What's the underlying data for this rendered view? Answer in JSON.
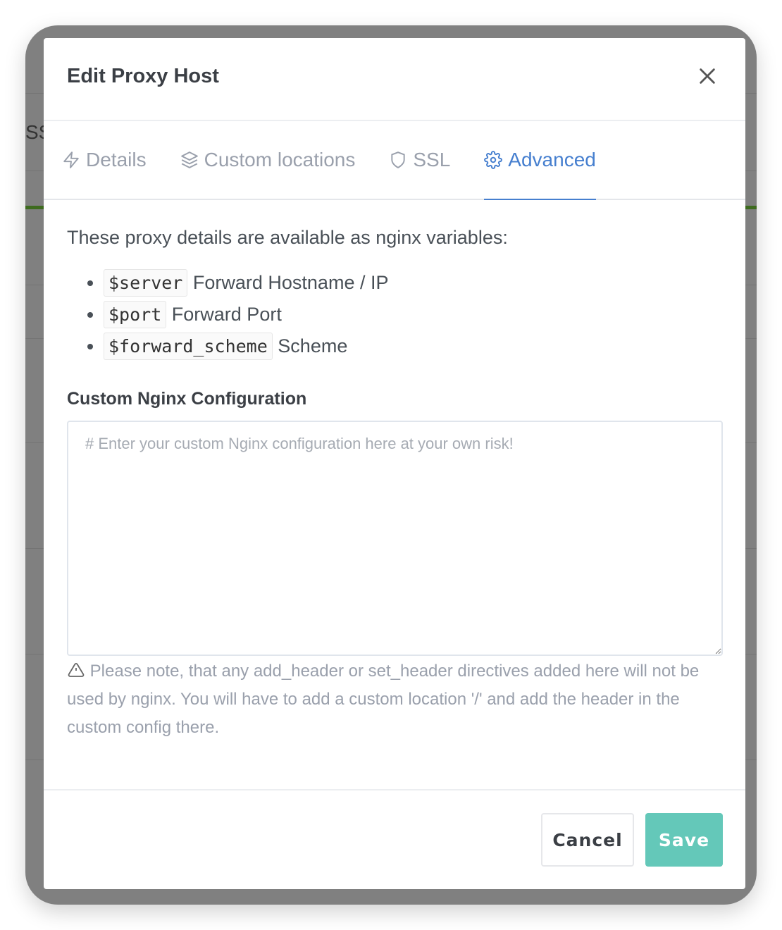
{
  "background": {
    "partial_text": "SSL"
  },
  "modal": {
    "title": "Edit Proxy Host",
    "tabs": [
      {
        "label": "Details",
        "icon": "zap-icon",
        "active": false
      },
      {
        "label": "Custom locations",
        "icon": "layers-icon",
        "active": false
      },
      {
        "label": "SSL",
        "icon": "shield-icon",
        "active": false
      },
      {
        "label": "Advanced",
        "icon": "settings-icon",
        "active": true
      }
    ],
    "intro": "These proxy details are available as nginx variables:",
    "variables": [
      {
        "code": "$server",
        "desc": "Forward Hostname / IP"
      },
      {
        "code": "$port",
        "desc": "Forward Port"
      },
      {
        "code": "$forward_scheme",
        "desc": "Scheme"
      }
    ],
    "config_label": "Custom Nginx Configuration",
    "config_value": "",
    "config_placeholder": "# Enter your custom Nginx configuration here at your own risk!",
    "note": "Please note, that any add_header or set_header directives added here will not be used by nginx. You will have to add a custom location '/' and add the header in the custom config there.",
    "cancel_label": "Cancel",
    "save_label": "Save"
  },
  "colors": {
    "accent": "#467fcf",
    "save": "#64c8b9"
  }
}
